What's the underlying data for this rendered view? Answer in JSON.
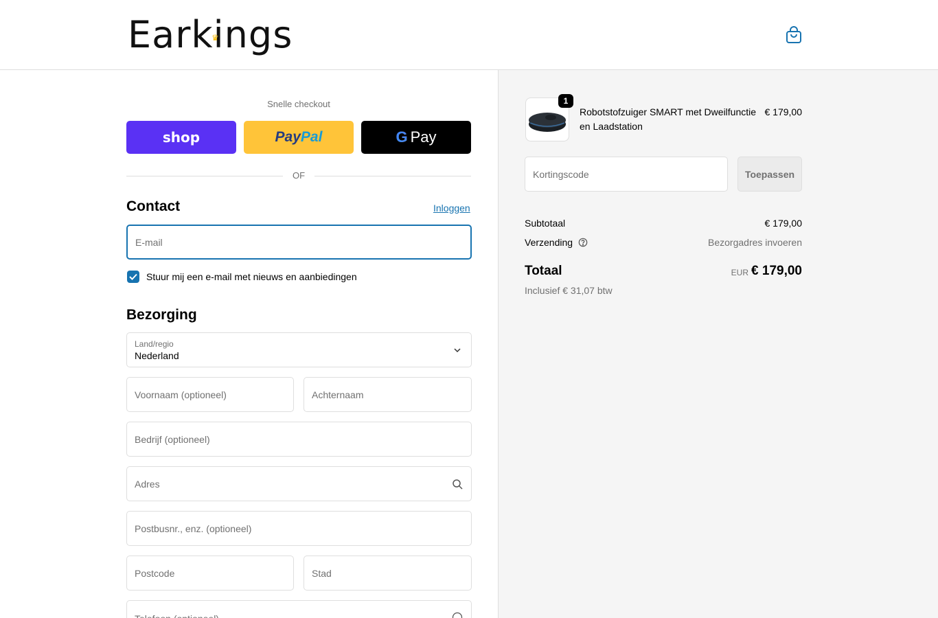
{
  "header": {
    "logo": "Earkings",
    "logo_crown": "♛"
  },
  "express": {
    "title": "Snelle checkout",
    "shop": "shop",
    "paypal_a": "Pay",
    "paypal_b": "Pal",
    "gpay_g": "G",
    "gpay_text": "Pay"
  },
  "divider": "OF",
  "contact": {
    "heading": "Contact",
    "login": "Inloggen",
    "email_placeholder": "E-mail",
    "newsletter": "Stuur mij een e-mail met nieuws en aanbiedingen"
  },
  "delivery": {
    "heading": "Bezorging",
    "country_label": "Land/regio",
    "country_value": "Nederland",
    "firstname": "Voornaam (optioneel)",
    "lastname": "Achternaam",
    "company": "Bedrijf (optioneel)",
    "address": "Adres",
    "apartment": "Postbusnr., enz. (optioneel)",
    "postcode": "Postcode",
    "city": "Stad",
    "phone": "Telefoon (optioneel)"
  },
  "summary": {
    "product_name": "Robotstofzuiger SMART met Dweilfunctie en Laadstation",
    "product_price": "€ 179,00",
    "quantity": "1",
    "discount_placeholder": "Kortingscode",
    "apply": "Toepassen",
    "subtotal_label": "Subtotaal",
    "subtotal_value": "€ 179,00",
    "shipping_label": "Verzending",
    "shipping_value": "Bezorgadres invoeren",
    "total_label": "Totaal",
    "total_currency": "EUR",
    "total_value": "€ 179,00",
    "tax_note": "Inclusief € 31,07 btw"
  },
  "colors": {
    "accent": "#1773b0",
    "shop_pay": "#5a31f4",
    "paypal": "#ffc439"
  }
}
